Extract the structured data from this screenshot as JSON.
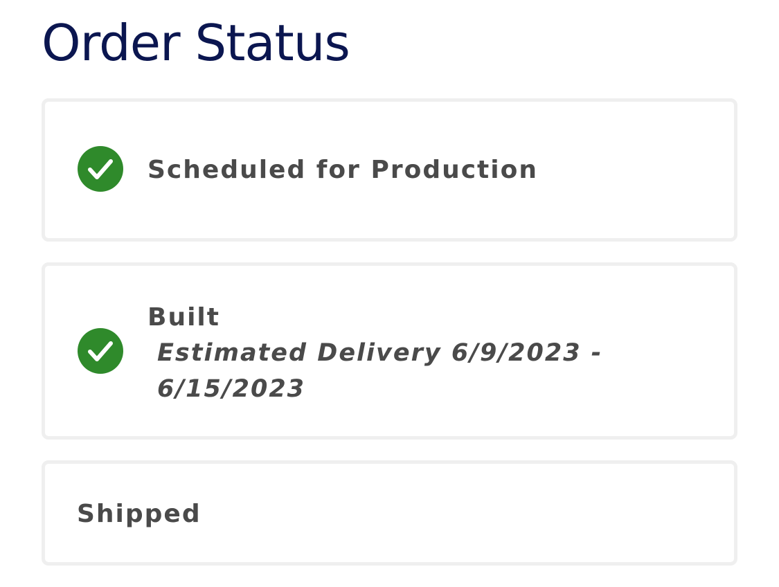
{
  "page": {
    "title": "Order Status"
  },
  "steps": [
    {
      "title": "Scheduled for Production",
      "completed": true,
      "icon": "checkmark-circle-icon"
    },
    {
      "title": "Built",
      "subtitle": "Estimated Delivery 6/9/2023 - 6/15/2023",
      "completed": true,
      "icon": "checkmark-circle-icon"
    },
    {
      "title": "Shipped",
      "completed": false
    }
  ],
  "colors": {
    "title": "#0b1650",
    "text": "#4a4a4a",
    "complete": "#2f8a2b",
    "card_border": "#efefef"
  }
}
